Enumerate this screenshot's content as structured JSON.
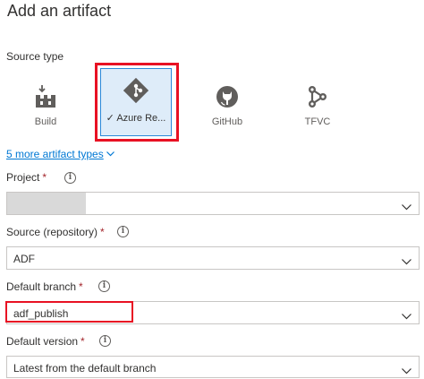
{
  "header": {
    "title": "Add an artifact"
  },
  "source_type": {
    "label": "Source type",
    "tiles": [
      {
        "label": "Build",
        "icon": "build-icon",
        "selected": false
      },
      {
        "label": "Azure Re...",
        "icon": "azure-repos-icon",
        "selected": true
      },
      {
        "label": "GitHub",
        "icon": "github-icon",
        "selected": false
      },
      {
        "label": "TFVC",
        "icon": "tfvc-icon",
        "selected": false
      }
    ],
    "check_glyph": "✓",
    "more_link": "5 more artifact types"
  },
  "form": {
    "required_mark": "*",
    "project": {
      "label": "Project",
      "value": ""
    },
    "repository": {
      "label": "Source (repository)",
      "value": "ADF"
    },
    "branch": {
      "label": "Default branch",
      "value": "adf_publish"
    },
    "version": {
      "label": "Default version",
      "value": "Latest from the default branch"
    }
  },
  "colors": {
    "accent": "#0078d4",
    "selected_tile_bg": "#deecf9",
    "highlight_red": "#e81123",
    "required_red": "#a4262c"
  }
}
